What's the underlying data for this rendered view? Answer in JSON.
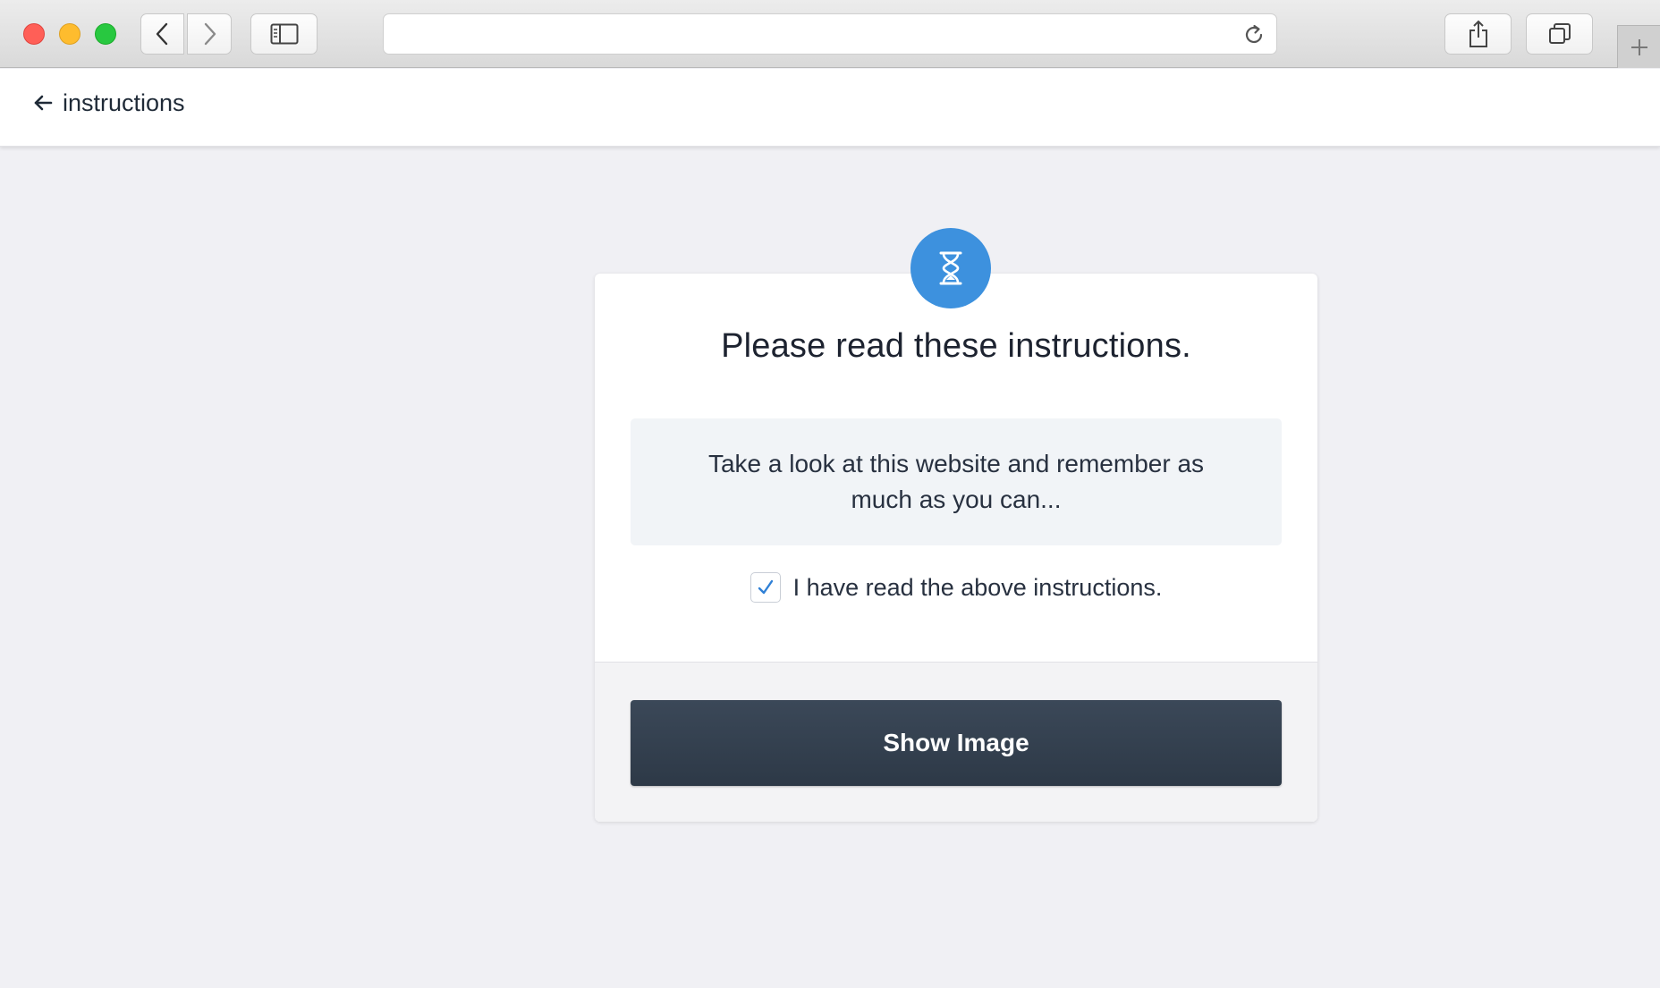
{
  "browser": {
    "url_value": "",
    "icons": {
      "back": "chevron-left-icon",
      "forward": "chevron-right-icon",
      "sidebar": "sidebar-icon",
      "reload": "reload-icon",
      "share": "share-icon",
      "tabs": "tabs-icon",
      "new_tab": "plus-icon"
    }
  },
  "header": {
    "back_label": "instructions",
    "back_icon": "arrow-left-icon"
  },
  "card": {
    "badge_icon": "hourglass-icon",
    "title": "Please read these instructions.",
    "instruction_text": "Take a look at this website and remember as much as you can...",
    "confirm_label": "I have read the above instructions.",
    "confirm_checked": true,
    "show_button_label": "Show Image"
  },
  "colors": {
    "accent": "#3d91de",
    "button_dark": "#354252",
    "page_background": "#f0f0f4"
  }
}
